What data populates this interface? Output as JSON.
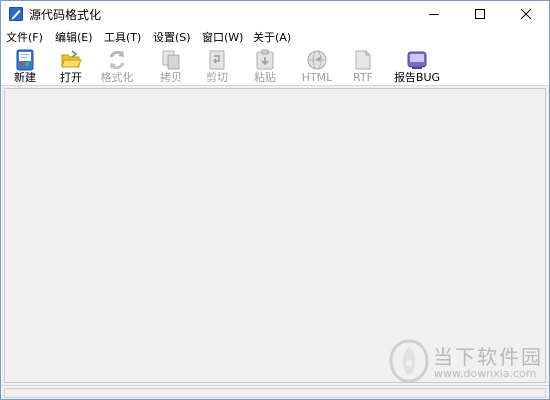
{
  "window": {
    "title": "源代码格式化",
    "controls": {
      "minimize_icon": "minimize-icon",
      "maximize_icon": "maximize-icon",
      "close_icon": "close-icon"
    }
  },
  "menu": {
    "items": [
      {
        "label": "文件(F)"
      },
      {
        "label": "编辑(E)"
      },
      {
        "label": "工具(T)"
      },
      {
        "label": "设置(S)"
      },
      {
        "label": "窗口(W)"
      },
      {
        "label": "关于(A)"
      }
    ]
  },
  "toolbar": {
    "items": [
      {
        "label": "新建",
        "icon": "new-document-icon",
        "enabled": true
      },
      {
        "label": "打开",
        "icon": "open-folder-icon",
        "enabled": true
      },
      {
        "label": "格式化",
        "icon": "format-icon",
        "enabled": false
      },
      {
        "label": "拷贝",
        "icon": "copy-icon",
        "enabled": false
      },
      {
        "label": "剪切",
        "icon": "cut-icon",
        "enabled": false
      },
      {
        "label": "粘贴",
        "icon": "paste-icon",
        "enabled": false
      },
      {
        "label": "HTML",
        "icon": "html-icon",
        "enabled": false
      },
      {
        "label": "RTF",
        "icon": "rtf-icon",
        "enabled": false
      },
      {
        "label": "报告BUG",
        "icon": "report-bug-icon",
        "enabled": true
      }
    ]
  },
  "statusbar": {
    "text": ""
  },
  "watermark": {
    "name": "当下软件园",
    "url": "www.downxia.com"
  },
  "colors": {
    "window_border": "#7a9bbd",
    "workspace_bg": "#f0f0f0",
    "disabled_text": "#a0a0a0"
  }
}
